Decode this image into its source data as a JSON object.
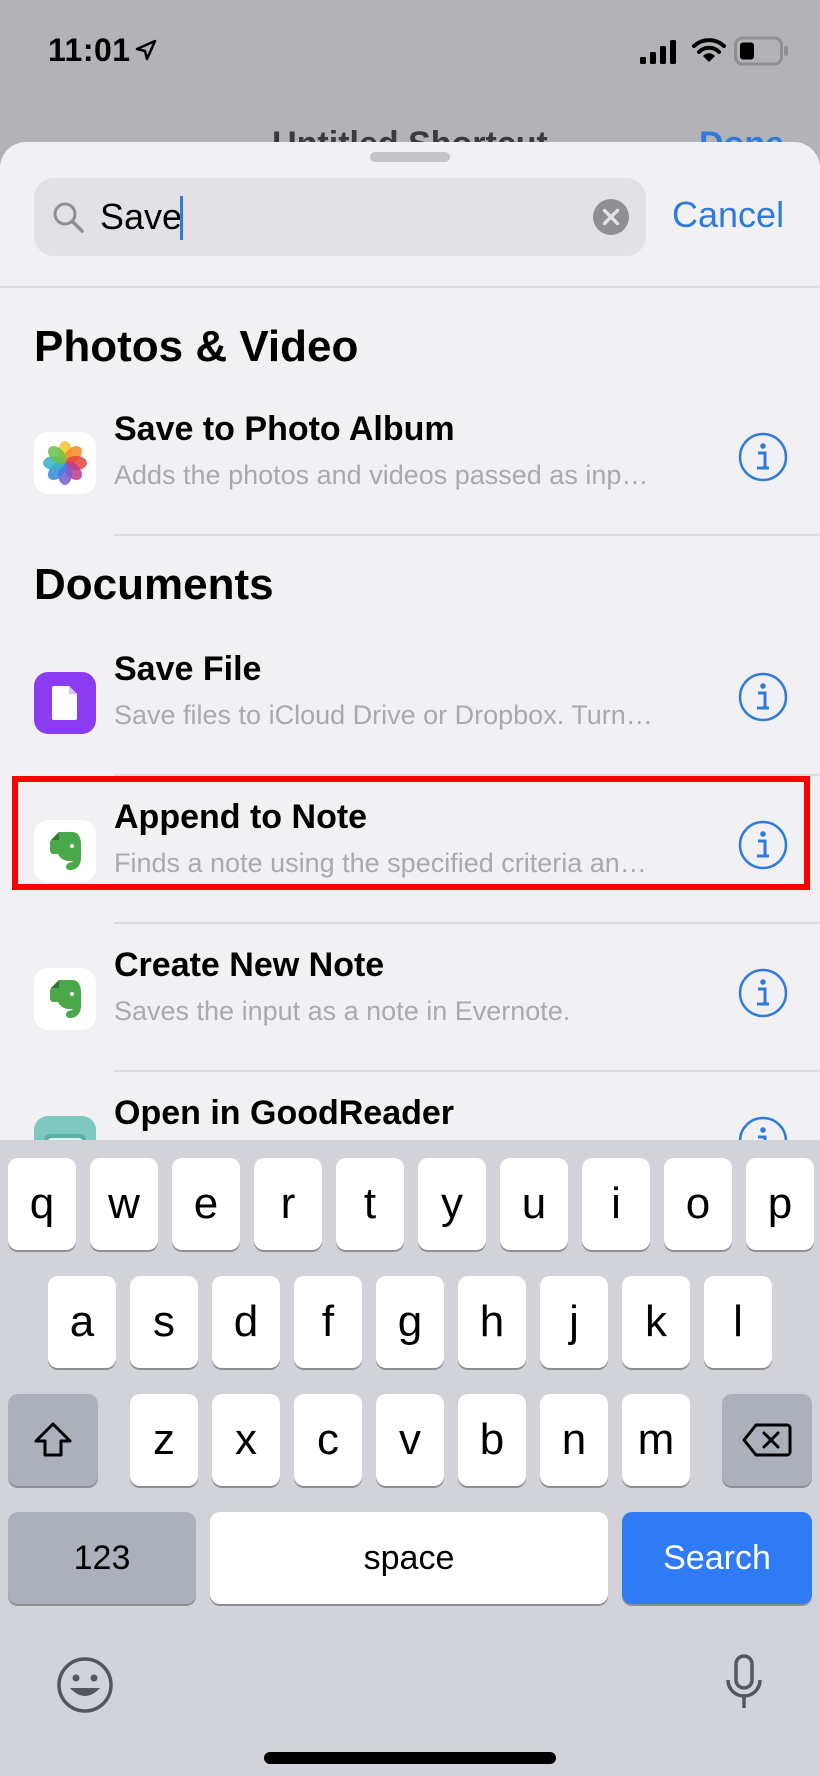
{
  "status_bar": {
    "time": "11:01"
  },
  "underlying": {
    "title": "Untitled Shortcut",
    "done_label": "Done"
  },
  "search": {
    "query": "Save",
    "cancel_label": "Cancel"
  },
  "sections": [
    {
      "title": "Photos & Video",
      "items": [
        {
          "title": "Save to Photo Album",
          "subtitle": "Adds the photos and videos passed as inp…",
          "icon": "photos-app-icon"
        }
      ]
    },
    {
      "title": "Documents",
      "items": [
        {
          "title": "Save File",
          "subtitle": "Save files to iCloud Drive or Dropbox. Turn…",
          "icon": "files-icon"
        },
        {
          "title": "Append to Note",
          "subtitle": "Finds a note using the specified criteria an…",
          "icon": "evernote-icon"
        },
        {
          "title": "Create New Note",
          "subtitle": "Saves the input as a note in Evernote.",
          "icon": "evernote-icon"
        },
        {
          "title": "Open in GoodReader",
          "subtitle": "",
          "icon": "goodreader-icon"
        }
      ]
    }
  ],
  "keyboard": {
    "row1": [
      "q",
      "w",
      "e",
      "r",
      "t",
      "y",
      "u",
      "i",
      "o",
      "p"
    ],
    "row2": [
      "a",
      "s",
      "d",
      "f",
      "g",
      "h",
      "j",
      "k",
      "l"
    ],
    "row3": [
      "z",
      "x",
      "c",
      "v",
      "b",
      "n",
      "m"
    ],
    "numbers_label": "123",
    "space_label": "space",
    "search_label": "Search"
  },
  "colors": {
    "accent": "#2f7bd9",
    "highlight": "#ff0000",
    "files_purple": "#8b3cf0",
    "evernote_green": "#4aa74a"
  }
}
